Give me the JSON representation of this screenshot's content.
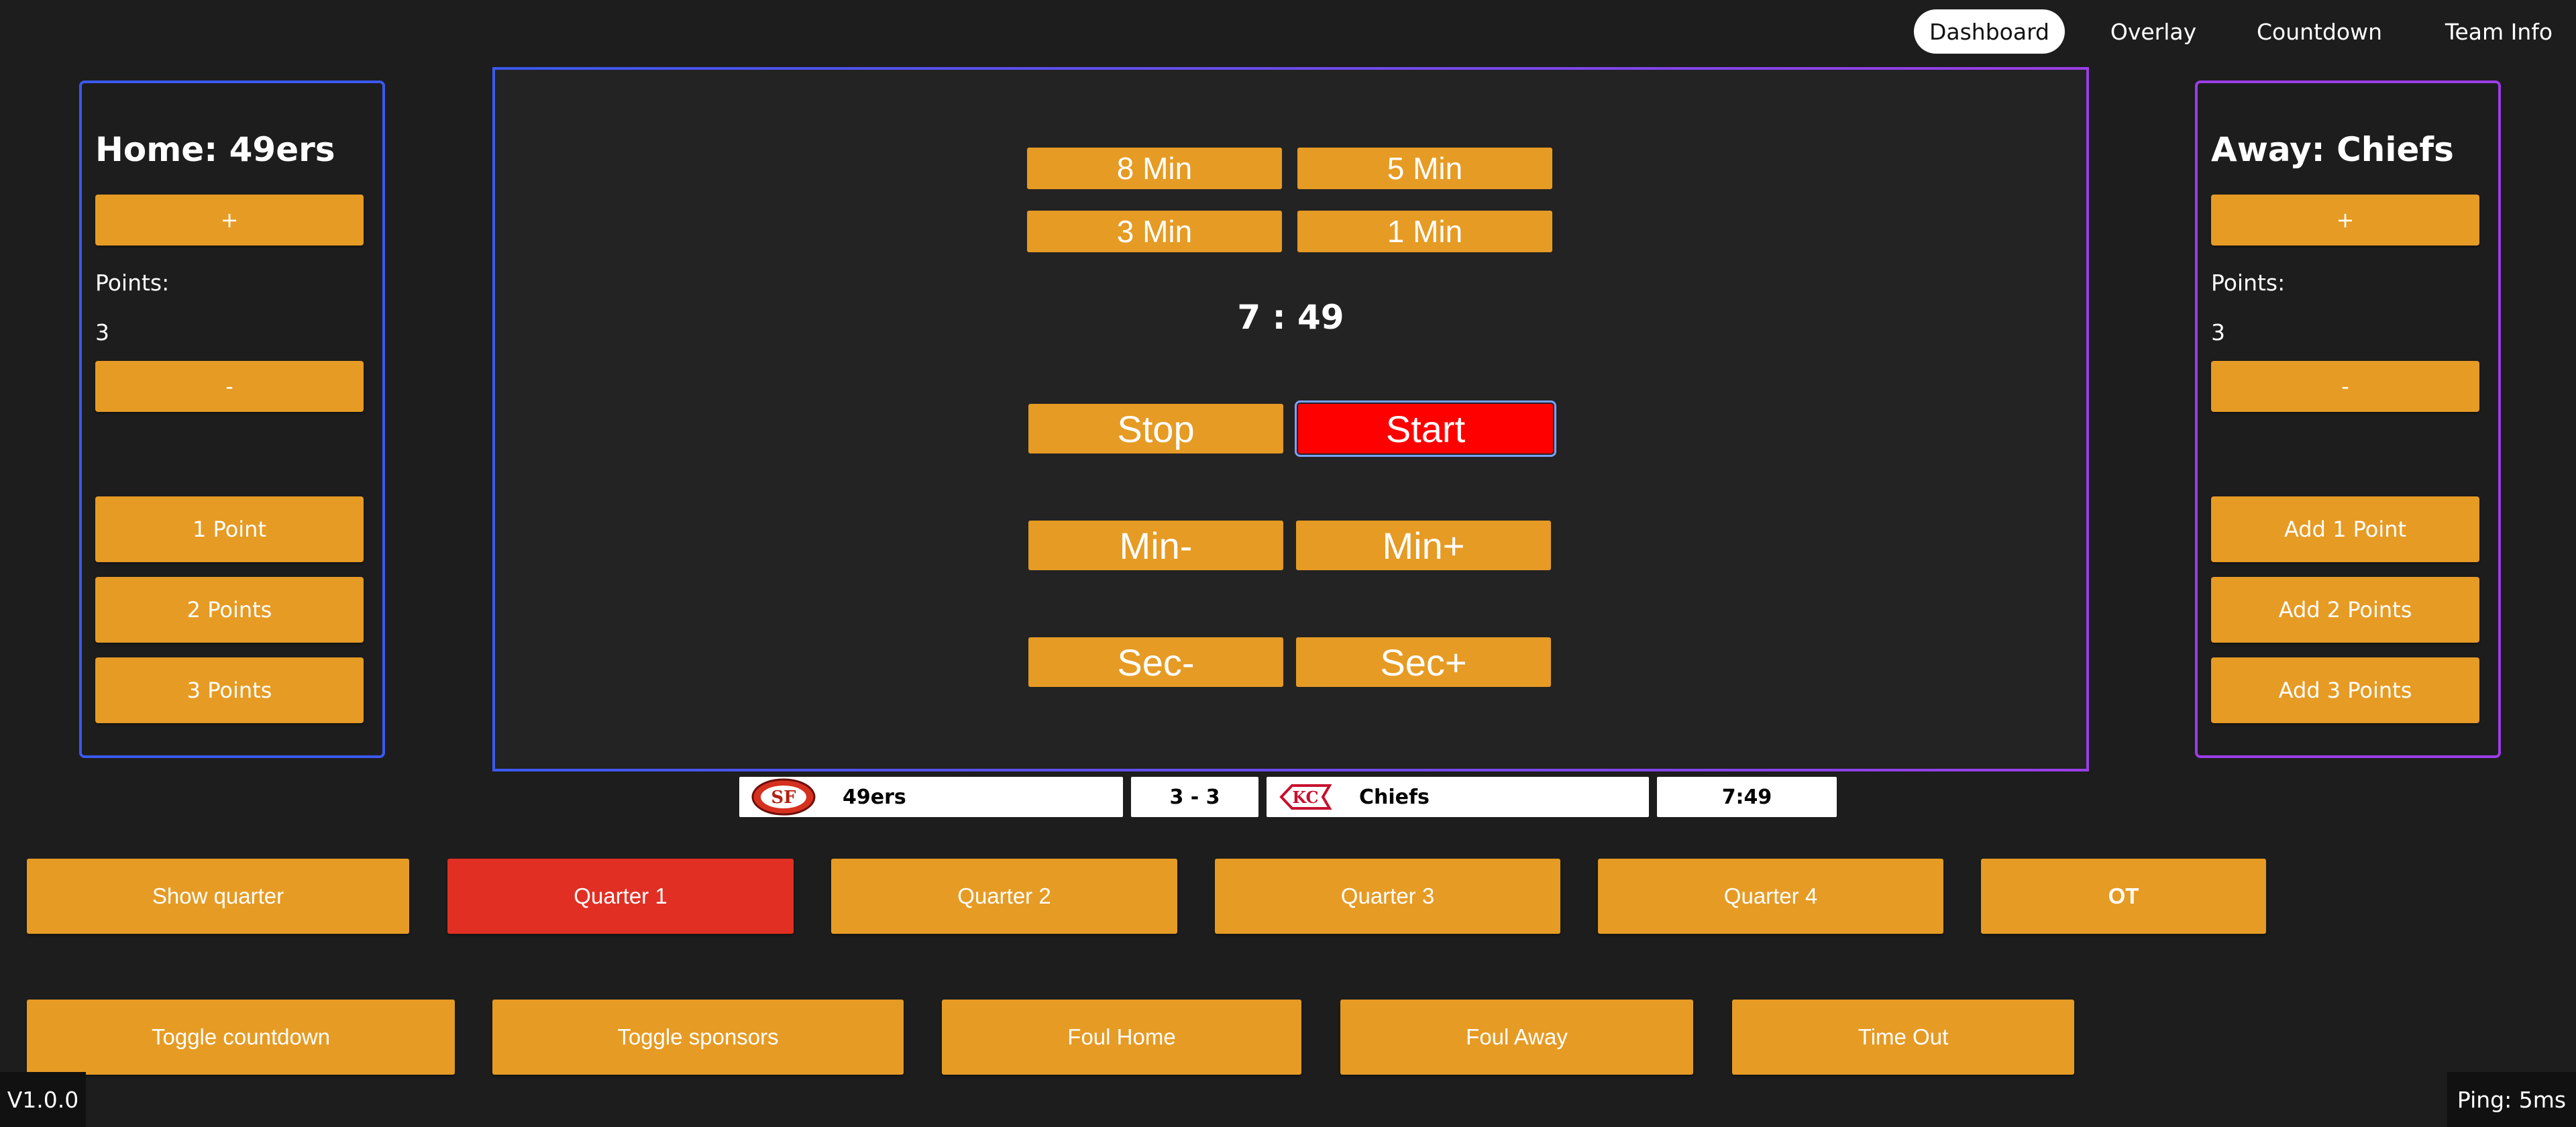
{
  "nav": {
    "items": [
      "Dashboard",
      "Overlay",
      "Countdown",
      "Team Info"
    ],
    "active": "Dashboard"
  },
  "home": {
    "title": "Home: 49ers",
    "plus_label": "+",
    "points_label": "Points:",
    "points_value": "3",
    "minus_label": "-",
    "buttons": [
      "1 Point",
      "2 Points",
      "3 Points"
    ]
  },
  "away": {
    "title": "Away: Chiefs",
    "plus_label": "+",
    "points_label": "Points:",
    "points_value": "3",
    "minus_label": "-",
    "buttons": [
      "Add 1 Point",
      "Add 2 Points",
      "Add 3 Points"
    ]
  },
  "timer": {
    "presets": [
      "8 Min",
      "5 Min",
      "3 Min",
      "1 Min"
    ],
    "readout": "7 : 49",
    "stop_label": "Stop",
    "start_label": "Start",
    "min_minus_label": "Min-",
    "min_plus_label": "Min+",
    "sec_minus_label": "Sec-",
    "sec_plus_label": "Sec+"
  },
  "scorebug": {
    "home_team": "49ers",
    "score": "3 - 3",
    "away_team": "Chiefs",
    "clock": "7:49",
    "home_logo_icon": "49ers-logo-icon",
    "away_logo_icon": "chiefs-logo-icon"
  },
  "quarters": {
    "show_label": "Show quarter",
    "items": [
      "Quarter 1",
      "Quarter 2",
      "Quarter 3",
      "Quarter 4",
      "OT"
    ],
    "active": "Quarter 1"
  },
  "actions": [
    "Toggle countdown",
    "Toggle sponsors",
    "Foul Home",
    "Foul Away",
    "Time Out"
  ],
  "footer": {
    "version": "V1.0.0",
    "ping": "Ping: 5ms"
  },
  "colors": {
    "background": "#1d1d1d",
    "button": "#e69b24",
    "active_red": "#e22f23",
    "start_red": "#ff0000",
    "home_border": "#3b59f0",
    "away_border": "#9c3de8"
  }
}
